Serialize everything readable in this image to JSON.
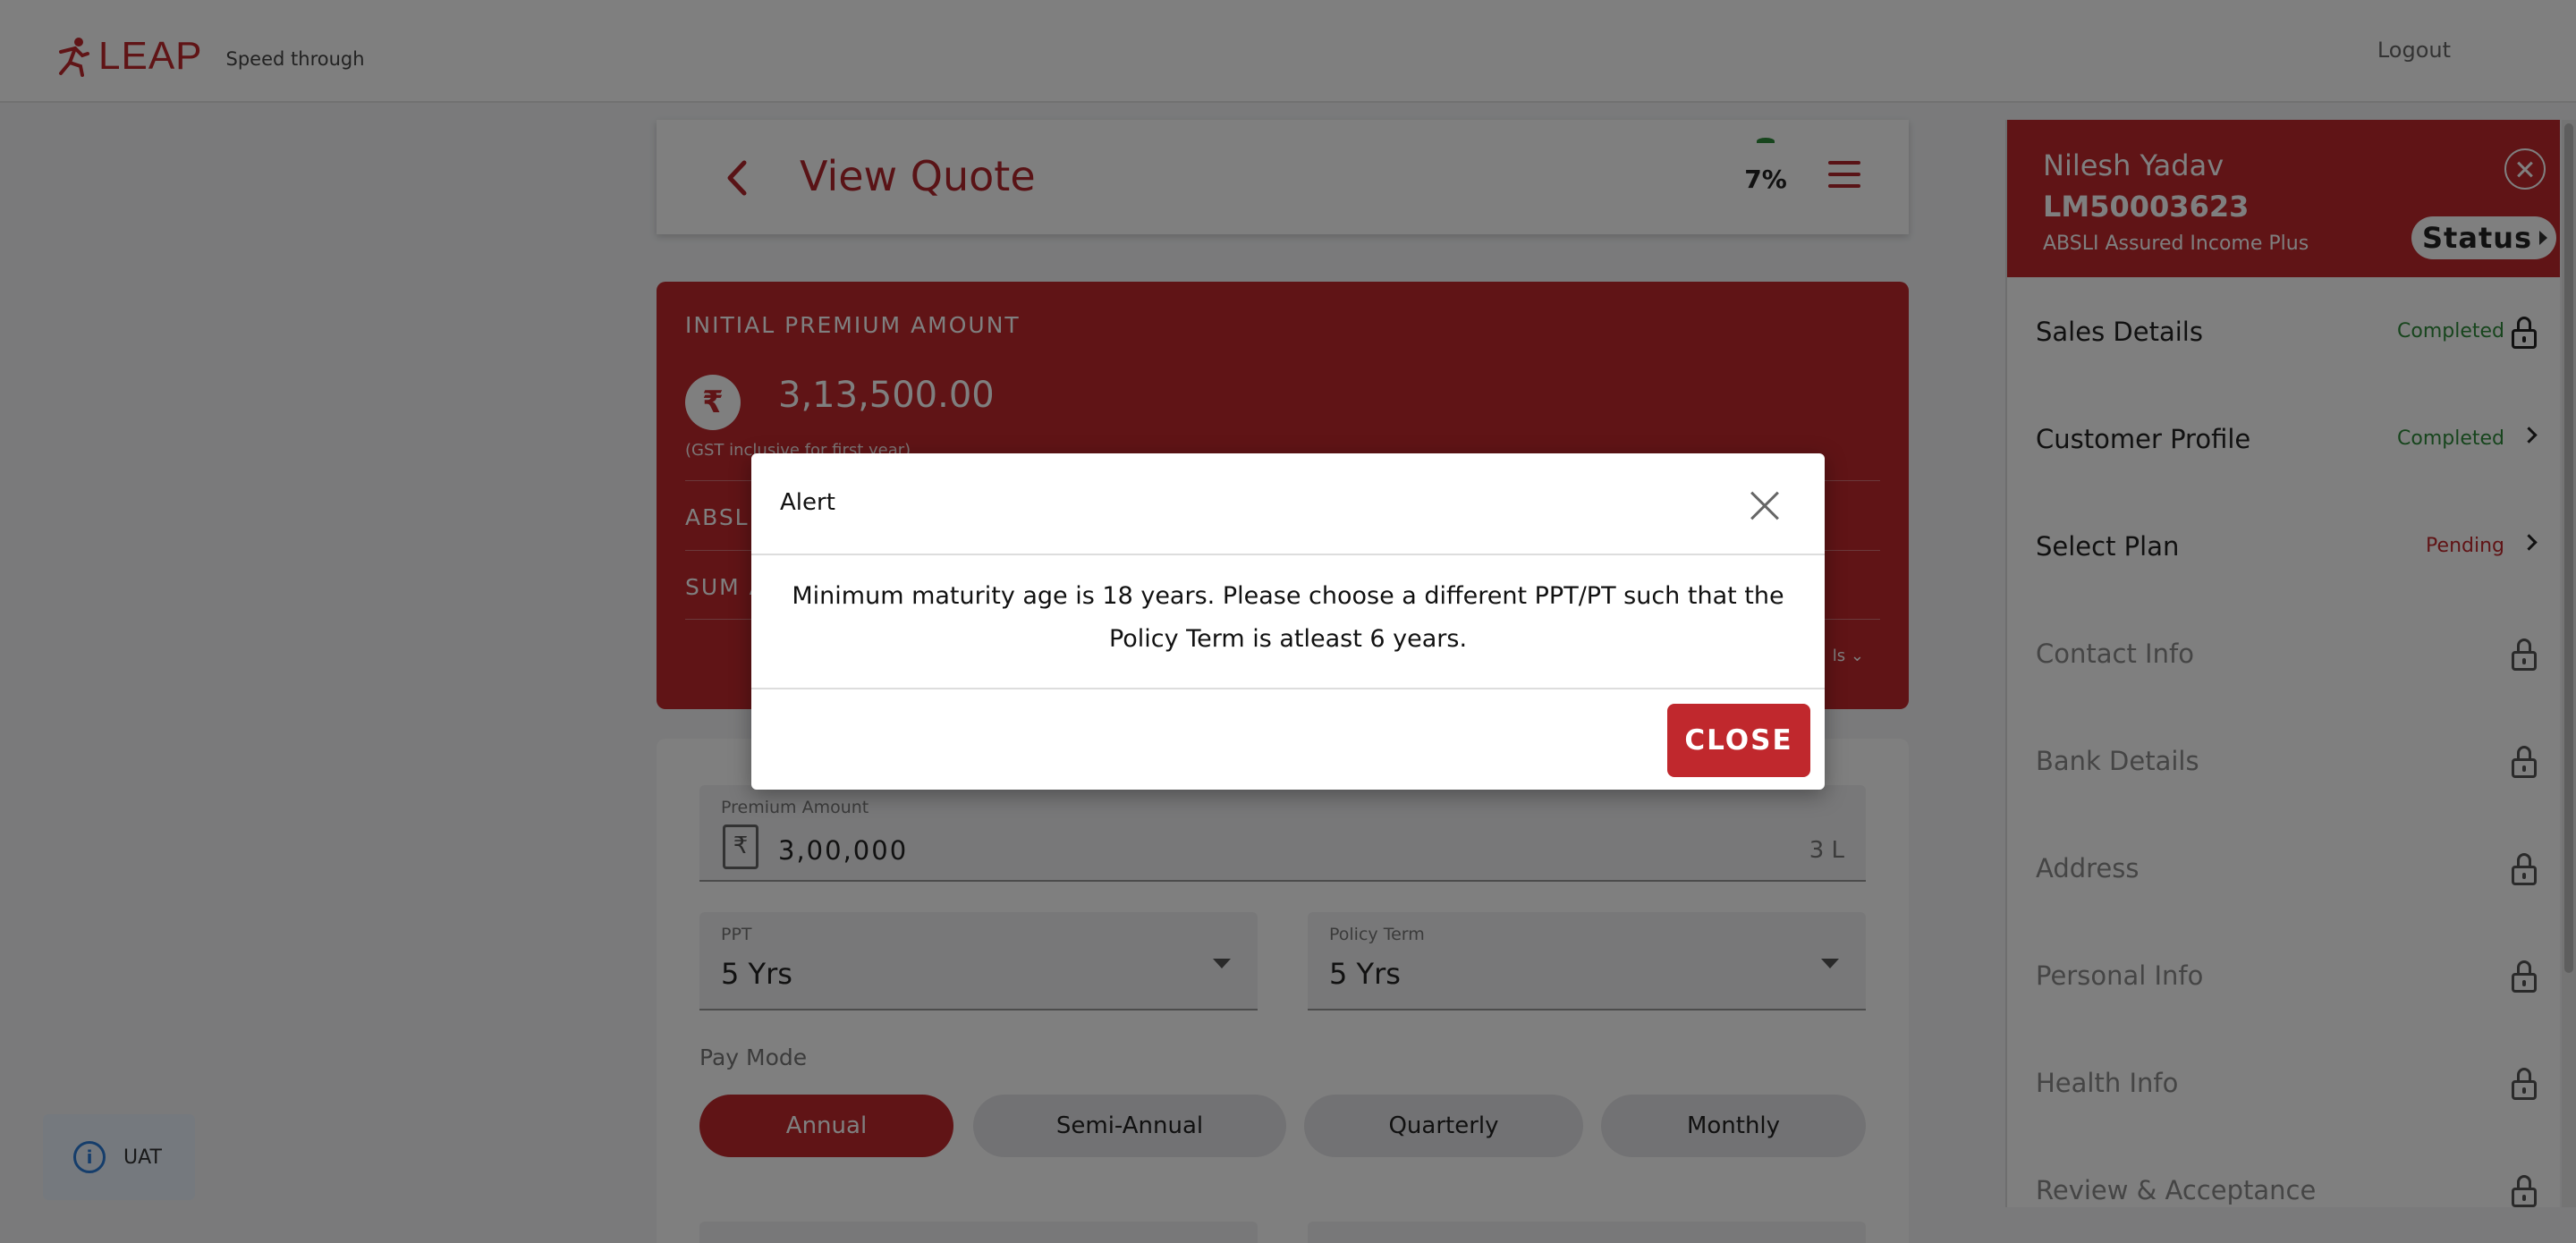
{
  "header": {
    "brand": "LEAP",
    "tagline": "Speed through",
    "logout": "Logout"
  },
  "quote": {
    "title": "View Quote",
    "progress_percent": 7,
    "progress_label": "7%"
  },
  "premium_card": {
    "label": "INITIAL PREMIUM AMOUNT",
    "currency_symbol": "₹",
    "amount": "3,13,500.00",
    "gst_note": "(GST inclusive for first year)",
    "row1_label": "ABSLI",
    "row2_label": "SUM A",
    "more_label": "ls"
  },
  "form": {
    "premium_label": "Premium Amount",
    "premium_value": "3,00,000",
    "premium_suffix": "3 L",
    "ppt_label": "PPT",
    "ppt_value": "5 Yrs",
    "pt_label": "Policy Term",
    "pt_value": "5 Yrs",
    "paymode_label": "Pay Mode",
    "paymodes": [
      "Annual",
      "Semi-Annual",
      "Quarterly",
      "Monthly"
    ],
    "selected_paymode": "Annual"
  },
  "side_panel": {
    "customer_name": "Nilesh Yadav",
    "lead_id": "LM50003623",
    "plan": "ABSLI Assured Income Plus",
    "status_button": "Status",
    "steps": [
      {
        "name": "Sales Details",
        "status": "Completed",
        "state": "completed-locked"
      },
      {
        "name": "Customer Profile",
        "status": "Completed",
        "state": "completed"
      },
      {
        "name": "Select Plan",
        "status": "Pending",
        "state": "pending"
      },
      {
        "name": "Contact Info",
        "status": "",
        "state": "locked"
      },
      {
        "name": "Bank Details",
        "status": "",
        "state": "locked"
      },
      {
        "name": "Address",
        "status": "",
        "state": "locked"
      },
      {
        "name": "Personal Info",
        "status": "",
        "state": "locked"
      },
      {
        "name": "Health Info",
        "status": "",
        "state": "locked"
      },
      {
        "name": "Review & Acceptance",
        "status": "",
        "state": "locked"
      }
    ]
  },
  "env_badge": {
    "icon": "info-icon",
    "label": "UAT"
  },
  "modal": {
    "title": "Alert",
    "message": "Minimum maturity age is 18 years. Please choose a different PPT/PT such that the Policy Term is atleast 6 years.",
    "button": "CLOSE"
  },
  "colors": {
    "brand_red": "#c0282d",
    "completed_green": "#2e8a3a",
    "info_blue": "#2b7bd6"
  }
}
